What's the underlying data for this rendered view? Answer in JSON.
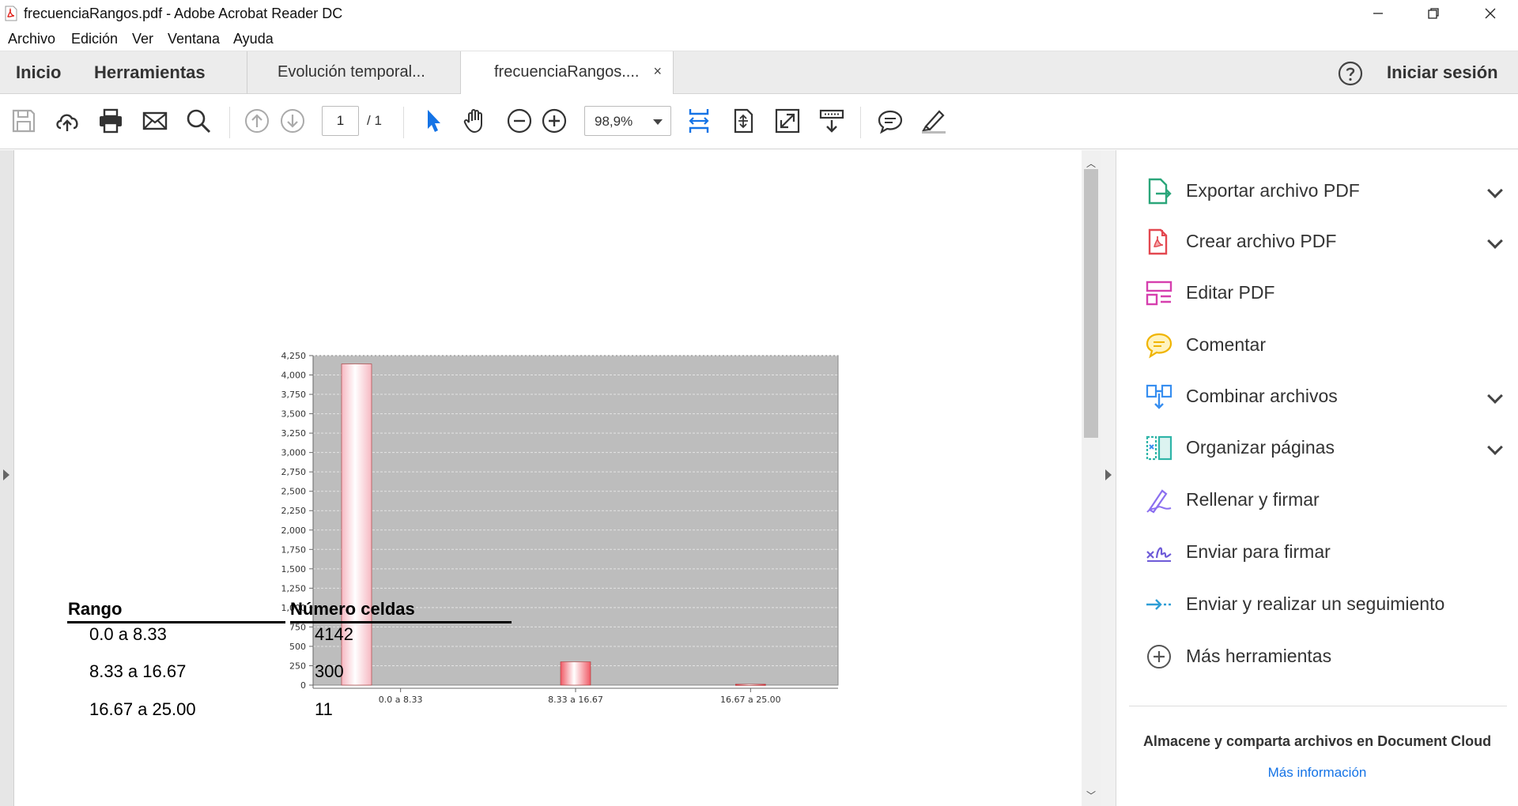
{
  "window": {
    "title": "frecuenciaRangos.pdf - Adobe Acrobat Reader DC",
    "icon": "pdf-file-icon"
  },
  "menu": [
    "Archivo",
    "Edición",
    "Ver",
    "Ventana",
    "Ayuda"
  ],
  "tabs": {
    "home": "Inicio",
    "tools": "Herramientas",
    "documents": [
      {
        "label": "Evolución temporal...",
        "active": false
      },
      {
        "label": "frecuenciaRangos....",
        "active": true,
        "close": "×"
      }
    ],
    "signin": "Iniciar sesión"
  },
  "toolbar": {
    "page_current": "1",
    "page_total": "/ 1",
    "zoom": "98,9%"
  },
  "chart_data": {
    "type": "bar",
    "categories": [
      "0.0 a 8.33",
      "8.33 a 16.67",
      "16.67 a 25.00"
    ],
    "values": [
      4142,
      300,
      11
    ],
    "ylim": [
      0,
      4250
    ],
    "yticks": [
      0,
      250,
      500,
      750,
      1000,
      1250,
      1500,
      1750,
      2000,
      2250,
      2500,
      2750,
      3000,
      3250,
      3500,
      3750,
      4000,
      4250
    ],
    "ytick_labels": [
      "0",
      "250",
      "500",
      "750",
      "1,000",
      "1,250",
      "1,500",
      "1,750",
      "2,000",
      "2,250",
      "2,500",
      "2,750",
      "3,000",
      "3,250",
      "3,500",
      "3,750",
      "4,000",
      "4,250"
    ],
    "grid": true,
    "background": "#bdbdbd",
    "bar_colors": [
      "#f6b8c2",
      "#f05a66",
      "#d8202e"
    ]
  },
  "table": {
    "headers": [
      "Rango",
      "Número celdas"
    ],
    "rows": [
      [
        "0.0 a 8.33",
        "4142"
      ],
      [
        "8.33 a 16.67",
        "300"
      ],
      [
        "16.67 a 25.00",
        "11"
      ]
    ]
  },
  "panel": {
    "tools": [
      {
        "label": "Exportar archivo PDF",
        "icon": "export-pdf-icon",
        "expand": true
      },
      {
        "label": "Crear archivo PDF",
        "icon": "create-pdf-icon",
        "expand": true
      },
      {
        "label": "Editar PDF",
        "icon": "edit-pdf-icon",
        "expand": false
      },
      {
        "label": "Comentar",
        "icon": "comment-icon",
        "expand": false
      },
      {
        "label": "Combinar archivos",
        "icon": "combine-files-icon",
        "expand": true
      },
      {
        "label": "Organizar páginas",
        "icon": "organize-pages-icon",
        "expand": true
      },
      {
        "label": "Rellenar y firmar",
        "icon": "fill-sign-icon",
        "expand": false
      },
      {
        "label": "Enviar para firmar",
        "icon": "send-sign-icon",
        "expand": false
      },
      {
        "label": "Enviar y realizar un seguimiento",
        "icon": "send-track-icon",
        "expand": false
      },
      {
        "label": "Más herramientas",
        "icon": "more-tools-icon",
        "expand": false
      }
    ],
    "cloud_text": "Almacene y comparta archivos en Document Cloud",
    "cloud_link": "Más información"
  }
}
